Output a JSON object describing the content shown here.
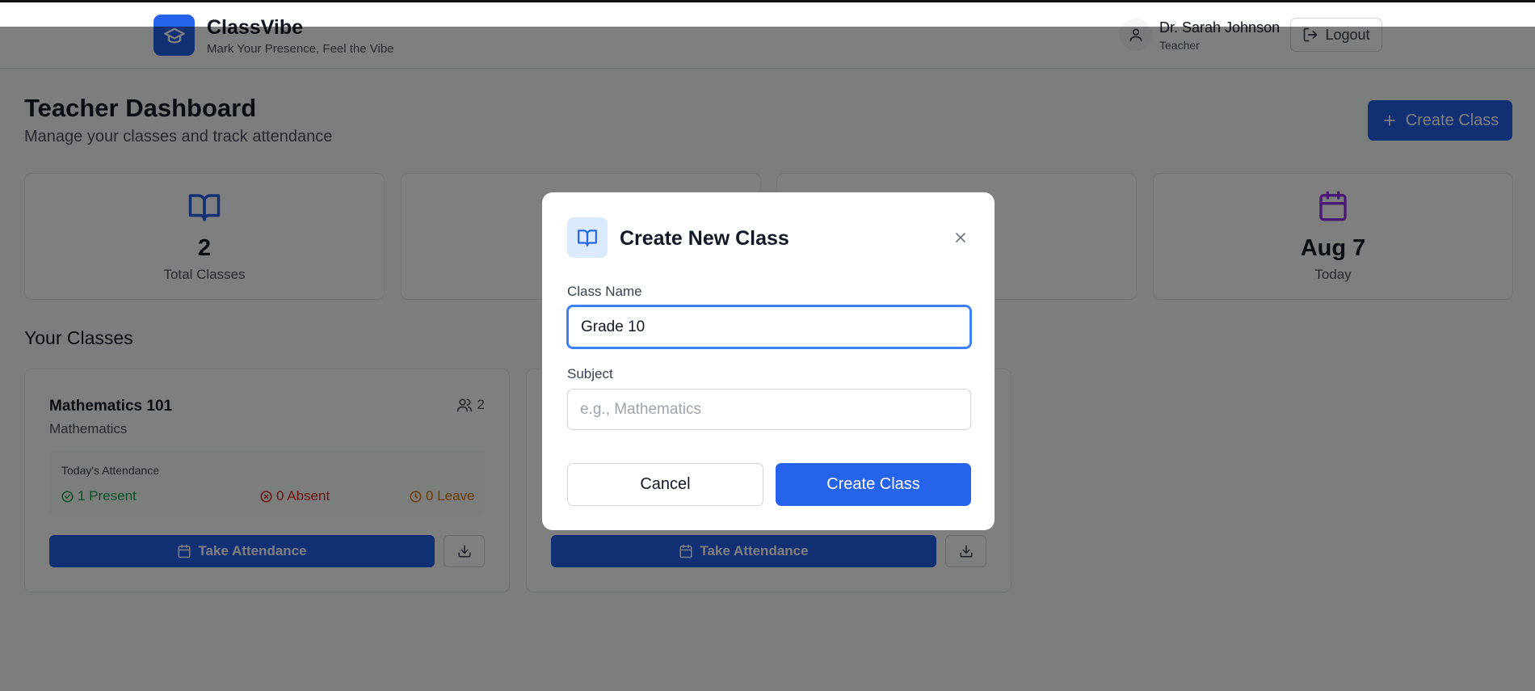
{
  "app": {
    "name": "ClassVibe",
    "tagline": "Mark Your Presence, Feel the Vibe",
    "brand_color": "#2563eb"
  },
  "user": {
    "name": "Dr. Sarah Johnson",
    "role": "Teacher",
    "logout_label": "Logout"
  },
  "dashboard": {
    "title": "Teacher Dashboard",
    "subtitle": "Manage your classes and track attendance",
    "create_button_label": "Create Class"
  },
  "stats": [
    {
      "icon": "book-open-icon",
      "value": "2",
      "label": "Total Classes",
      "color": "#2563eb"
    },
    {
      "icon": "users-icon",
      "value": "",
      "label": "",
      "color": "#16a34a"
    },
    {
      "icon": "check-icon",
      "value": "",
      "label": "",
      "color": "#2563eb"
    },
    {
      "icon": "calendar-icon",
      "value": "Aug 7",
      "label": "Today",
      "color": "#9333ea"
    }
  ],
  "classes_section": {
    "title": "Your Classes",
    "cards": [
      {
        "name": "Mathematics 101",
        "subject": "Mathematics",
        "student_count": "2",
        "attendance_title": "Today's Attendance",
        "present": "1 Present",
        "absent": "0 Absent",
        "leave": "0 Leave",
        "take_attendance_label": "Take Attendance"
      },
      {
        "name": "",
        "subject": "",
        "student_count": "",
        "attendance_title": "",
        "present": "",
        "absent": "",
        "leave": "",
        "take_attendance_label": "Take Attendance"
      }
    ]
  },
  "modal": {
    "title": "Create New Class",
    "class_name_label": "Class Name",
    "class_name_value": "Grade 10",
    "subject_label": "Subject",
    "subject_placeholder": "e.g., Mathematics",
    "cancel_label": "Cancel",
    "submit_label": "Create Class"
  },
  "colors": {
    "present": "#16a34a",
    "absent": "#dc2626",
    "leave": "#d97706"
  }
}
